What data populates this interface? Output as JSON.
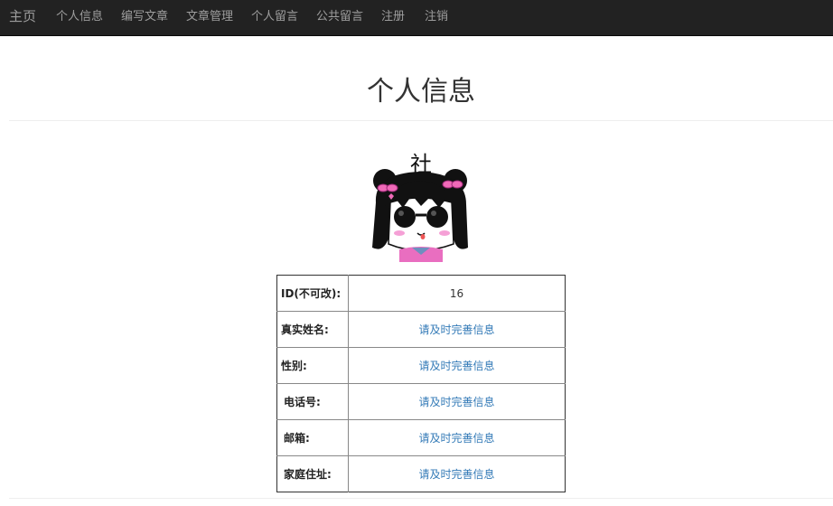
{
  "nav": {
    "brand": "主页",
    "items": [
      "个人信息",
      "编写文章",
      "文章管理",
      "个人留言",
      "公共留言",
      "注册",
      "注销"
    ]
  },
  "page": {
    "title": "个人信息"
  },
  "avatar": {
    "caption": "社会"
  },
  "profile": {
    "rows": [
      {
        "label": "ID(不可改):",
        "value": "16"
      },
      {
        "label": "真实姓名:",
        "value": "请及时完善信息"
      },
      {
        "label": "性别:",
        "value": "请及时完善信息"
      },
      {
        "label": "电话号:",
        "value": "请及时完善信息"
      },
      {
        "label": "邮箱:",
        "value": "请及时完善信息"
      },
      {
        "label": "家庭住址:",
        "value": "请及时完善信息"
      }
    ]
  },
  "colors": {
    "navbar_bg": "#222222",
    "nav_text": "#9d9d9d",
    "link": "#337ab7"
  }
}
